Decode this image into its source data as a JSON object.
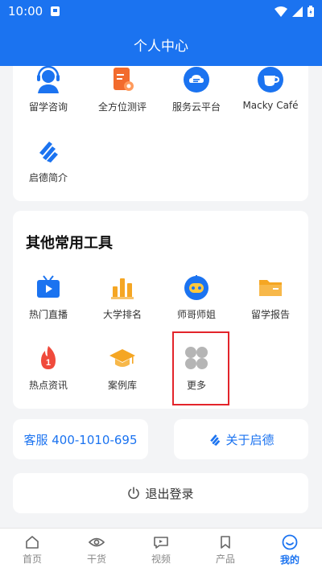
{
  "status_bar": {
    "time": "10:00"
  },
  "header": {
    "title": "个人中心"
  },
  "top_services": [
    {
      "label": "留学咨询",
      "icon": "consultant-headset-icon"
    },
    {
      "label": "全方位测评",
      "icon": "assessment-clipboard-icon"
    },
    {
      "label": "服务云平台",
      "icon": "cloud-platform-icon"
    },
    {
      "label": "Macky Café",
      "icon": "coffee-cup-icon"
    },
    {
      "label": "启德简介",
      "icon": "eic-logo-icon"
    }
  ],
  "tools": {
    "title": "其他常用工具",
    "items": [
      {
        "label": "热门直播",
        "icon": "live-tv-icon"
      },
      {
        "label": "大学排名",
        "icon": "ranking-bars-icon"
      },
      {
        "label": "师哥师姐",
        "icon": "robot-mentor-icon"
      },
      {
        "label": "留学报告",
        "icon": "folder-report-icon"
      },
      {
        "label": "热点资讯",
        "icon": "hot-news-flame-icon"
      },
      {
        "label": "案例库",
        "icon": "graduation-cap-icon"
      },
      {
        "label": "更多",
        "icon": "more-grid-icon"
      }
    ]
  },
  "actions": {
    "service_hotline": "客服 400-1010-695",
    "about": "关于启德",
    "logout": "退出登录"
  },
  "tabbar": [
    {
      "label": "首页",
      "icon": "home-icon",
      "active": false
    },
    {
      "label": "干货",
      "icon": "eye-icon",
      "active": false
    },
    {
      "label": "视频",
      "icon": "video-chat-icon",
      "active": false
    },
    {
      "label": "产品",
      "icon": "bookmark-icon",
      "active": false
    },
    {
      "label": "我的",
      "icon": "profile-face-icon",
      "active": true
    }
  ],
  "colors": {
    "primary": "#1b73f0",
    "highlight_border": "#e3242b",
    "page_bg": "#f3f4f6"
  }
}
